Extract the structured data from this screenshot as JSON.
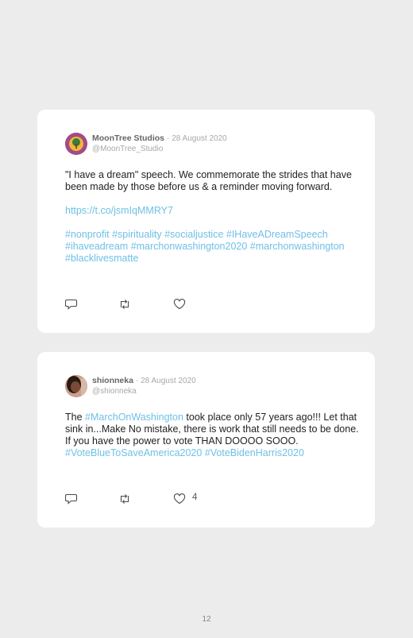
{
  "tweets": [
    {
      "name": "MoonTree Studios",
      "separator": "·",
      "date": "28 August 2020",
      "handle": "@MoonTree_Studio",
      "text_1": "\"I have a dream\" speech. We commemorate the strides that have been made by those before us & a reminder moving forward.",
      "link": "https://t.co/jsmIqMMRY7",
      "hashtags": "#nonprofit #spirituality #socialjustice #IHaveADreamSpeech #ihaveadream #marchonwashington2020 #marchonwashington #blacklivesmatte",
      "like_count": ""
    },
    {
      "name": "shionneka",
      "separator": "·",
      "date": "28 August 2020",
      "handle": "@shionneka",
      "text_pre": "The ",
      "hashtag_1": "#MarchOnWashington",
      "text_mid": " took place only 57 years ago!!! Let that sink in...Make No mistake, there is work that still needs to be done. If you have the power to vote THAN DOOOO SOOO. ",
      "hashtag_2": "#VoteBlueToSaveAmerica2020 #VoteBidenHarris2020",
      "like_count": "4"
    }
  ],
  "icons": {
    "reply": "reply-icon",
    "retweet": "retweet-icon",
    "like": "heart-icon"
  },
  "colors": {
    "link": "#6fc0e6",
    "background": "#ececec",
    "card": "#ffffff"
  },
  "page_number": "12"
}
